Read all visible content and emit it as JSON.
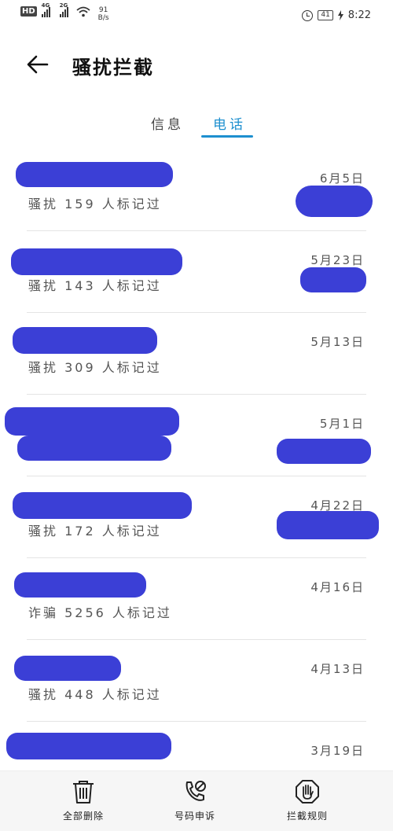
{
  "status_bar": {
    "hd": "HD",
    "net1": "4G",
    "net2": "2G",
    "speed_value": "91",
    "speed_unit": "B/s",
    "battery": "41",
    "time": "8:22"
  },
  "header": {
    "title": "骚扰拦截"
  },
  "tabs": [
    {
      "label": "信息",
      "active": false
    },
    {
      "label": "电话",
      "active": true
    }
  ],
  "accent_color": "#1d8fcf",
  "calls": [
    {
      "date": "6月5日",
      "tag": "骚扰 159 人标记过"
    },
    {
      "date": "5月23日",
      "tag": "骚扰 143 人标记过"
    },
    {
      "date": "5月13日",
      "tag": "骚扰 309 人标记过"
    },
    {
      "date": "5月1日",
      "tag": ""
    },
    {
      "date": "4月22日",
      "tag": "骚扰 172 人标记过"
    },
    {
      "date": "4月16日",
      "tag": "诈骗 5256 人标记过"
    },
    {
      "date": "4月13日",
      "tag": "骚扰 448 人标记过"
    },
    {
      "date": "3月19日",
      "tag": ""
    }
  ],
  "bottom_nav": {
    "delete_all": "全部删除",
    "appeal": "号码申诉",
    "rules": "拦截规则"
  }
}
